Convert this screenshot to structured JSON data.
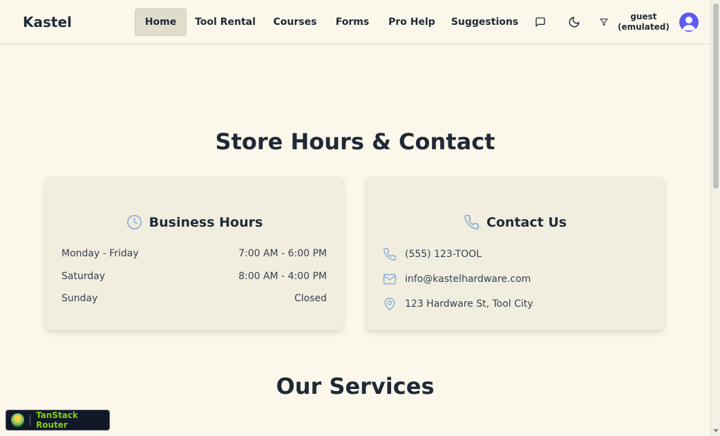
{
  "app": {
    "brand": "Kastel"
  },
  "nav": {
    "items": [
      {
        "label": "Home"
      },
      {
        "label": "Tool Rental"
      },
      {
        "label": "Courses"
      },
      {
        "label": "Forms"
      },
      {
        "label": "Pro Help"
      },
      {
        "label": "Suggestions"
      }
    ],
    "active": "Home",
    "user_line1": "guest",
    "user_line2": "(emulated)"
  },
  "store": {
    "title": "Store Hours & Contact",
    "hours": {
      "heading": "Business Hours",
      "rows": [
        {
          "day": "Monday - Friday",
          "time": "7:00 AM - 6:00 PM"
        },
        {
          "day": "Saturday",
          "time": "8:00 AM - 4:00 PM"
        },
        {
          "day": "Sunday",
          "time": "Closed"
        }
      ]
    },
    "contact": {
      "heading": "Contact Us",
      "phone": "(555) 123-TOOL",
      "email": "info@kastelhardware.com",
      "address": "123 Hardware St, Tool City"
    }
  },
  "services": {
    "title": "Our Services"
  },
  "devtools": {
    "label": "TanStack Router"
  },
  "colors": {
    "background": "#fbf7ea",
    "card": "#f1eedf",
    "active_nav": "#e0ddcc",
    "icon_accent": "#93b4d6",
    "avatar": "#5b5bf0",
    "devtools_text": "#84cc16"
  },
  "icons": {
    "feedback": "message-square-icon",
    "theme": "moon-icon",
    "user_filter": "filter-icon",
    "hours": "clock-icon",
    "contact": "phone-icon",
    "phone": "phone-icon",
    "email": "mail-icon",
    "address": "map-pin-icon"
  }
}
